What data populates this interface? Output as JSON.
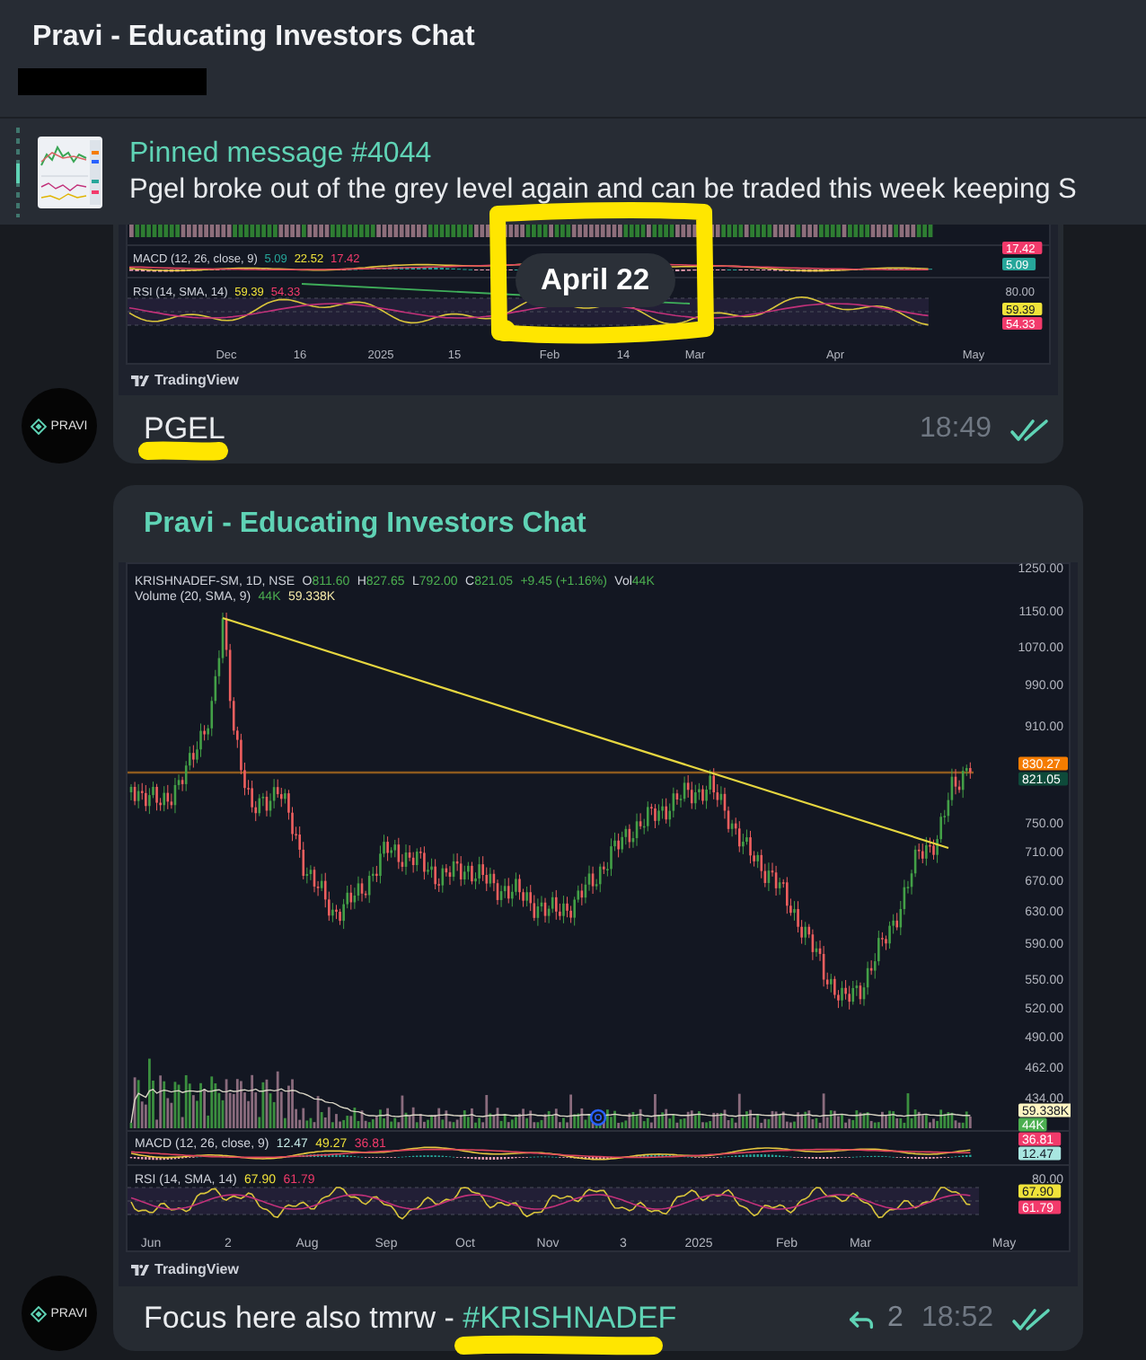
{
  "header": {
    "title": "Pravi - Educating Investors Chat"
  },
  "pinned": {
    "title": "Pinned message #4044",
    "text": "Pgel broke out of the grey level again and can be traded this week keeping S"
  },
  "date_badge": "April 22",
  "messages": [
    {
      "avatar_label": "PRAVI",
      "image": {
        "kind": "cropped",
        "macd_row": [
          {
            "value": "MACD (12, 26, close, 9)"
          },
          {
            "value": "5.09",
            "color": "#26a69a"
          },
          {
            "value": "22.52",
            "color": "#f0e33a"
          },
          {
            "value": "17.42",
            "color": "#f23a6b"
          }
        ],
        "rsi_row": [
          {
            "value": "RSI (14, SMA, 14)"
          },
          {
            "value": "59.39",
            "color": "#f0e33a"
          },
          {
            "value": "54.33",
            "color": "#f23a6b"
          }
        ],
        "axis_labels": [
          {
            "kind": "tag",
            "text": "17.42",
            "color": "#f23a6b"
          },
          {
            "kind": "tag",
            "text": "5.09",
            "color": "#26a69a"
          },
          {
            "kind": "tick",
            "text": "80.00"
          },
          {
            "kind": "tag",
            "text": "59.39",
            "color": "#f0e33a"
          },
          {
            "kind": "tag",
            "text": "54.33",
            "color": "#f23a6b"
          }
        ],
        "time_labels": [
          "Dec",
          "16",
          "2025",
          "15",
          "Feb",
          "14",
          "Mar",
          "Apr",
          "May"
        ],
        "footer": "TradingView"
      },
      "text": [
        {
          "kind": "plain",
          "text": "PGEL"
        }
      ],
      "time": "18:49",
      "read": true
    },
    {
      "avatar_label": "PRAVI",
      "sender": "Pravi - Educating Investors Chat",
      "image": {
        "kind": "full",
        "title_row": [
          {
            "value": "KRISHNADEF-SM, 1D, NSE"
          },
          {
            "label": "O",
            "value": "811.60",
            "color": "#4caf50"
          },
          {
            "label": "H",
            "value": "827.65",
            "color": "#4caf50"
          },
          {
            "label": "L",
            "value": "792.00",
            "color": "#4caf50"
          },
          {
            "label": "C",
            "value": "821.05",
            "color": "#4caf50"
          },
          {
            "value": "+9.45 (+1.16%)",
            "color": "#4caf50"
          },
          {
            "label": "Vol",
            "value": "44K",
            "color": "#4caf50"
          }
        ],
        "volume_row": [
          {
            "value": "Volume (20, SMA, 9)"
          },
          {
            "value": "44K",
            "color": "#4caf50"
          },
          {
            "value": "59.338K",
            "color": "#f5e9a8"
          }
        ],
        "macd_row": [
          {
            "value": "MACD (12, 26, close, 9)"
          },
          {
            "value": "12.47",
            "color": "#c8ece8"
          },
          {
            "value": "49.27",
            "color": "#f0e33a"
          },
          {
            "value": "36.81",
            "color": "#f23a6b"
          }
        ],
        "rsi_row": [
          {
            "value": "RSI (14, SMA, 14)"
          },
          {
            "value": "67.90",
            "color": "#f0e33a"
          },
          {
            "value": "61.79",
            "color": "#f23a6b"
          }
        ],
        "axis_labels": [
          {
            "kind": "tick",
            "text": "1250.00"
          },
          {
            "kind": "tick",
            "text": "1150.00"
          },
          {
            "kind": "tick",
            "text": "1070.00"
          },
          {
            "kind": "tick",
            "text": "990.00"
          },
          {
            "kind": "tick",
            "text": "910.00"
          },
          {
            "kind": "tag",
            "text": "830.27",
            "color": "#f57c00"
          },
          {
            "kind": "tag",
            "text": "821.05",
            "color": "#0e4a3a"
          },
          {
            "kind": "tick",
            "text": "750.00"
          },
          {
            "kind": "tick",
            "text": "710.00"
          },
          {
            "kind": "tick",
            "text": "670.00"
          },
          {
            "kind": "tick",
            "text": "630.00"
          },
          {
            "kind": "tick",
            "text": "590.00"
          },
          {
            "kind": "tick",
            "text": "550.00"
          },
          {
            "kind": "tick",
            "text": "520.00"
          },
          {
            "kind": "tick",
            "text": "490.00"
          },
          {
            "kind": "tick",
            "text": "462.00"
          },
          {
            "kind": "tick",
            "text": "434.00"
          },
          {
            "kind": "tag",
            "text": "59.338K",
            "color": "#fff5c2"
          },
          {
            "kind": "tag",
            "text": "44K",
            "color": "#4caf50"
          },
          {
            "kind": "tag",
            "text": "36.81",
            "color": "#f23a6b"
          },
          {
            "kind": "tag",
            "text": "12.47",
            "color": "#a8e6e0"
          },
          {
            "kind": "tick",
            "text": "80.00"
          },
          {
            "kind": "tag",
            "text": "67.90",
            "color": "#f0e33a"
          },
          {
            "kind": "tag",
            "text": "61.79",
            "color": "#f23a6b"
          }
        ],
        "time_labels": [
          "Jun",
          "2",
          "Aug",
          "Sep",
          "Oct",
          "Nov",
          "3",
          "2025",
          "Feb",
          "Mar",
          "May"
        ],
        "footer": "TradingView"
      },
      "text": [
        {
          "kind": "plain",
          "text": "Focus here also tmrw -"
        },
        {
          "kind": "hashtag",
          "text": "#KRISHNADEF"
        }
      ],
      "replies": "2",
      "time": "18:52",
      "read": true
    }
  ]
}
